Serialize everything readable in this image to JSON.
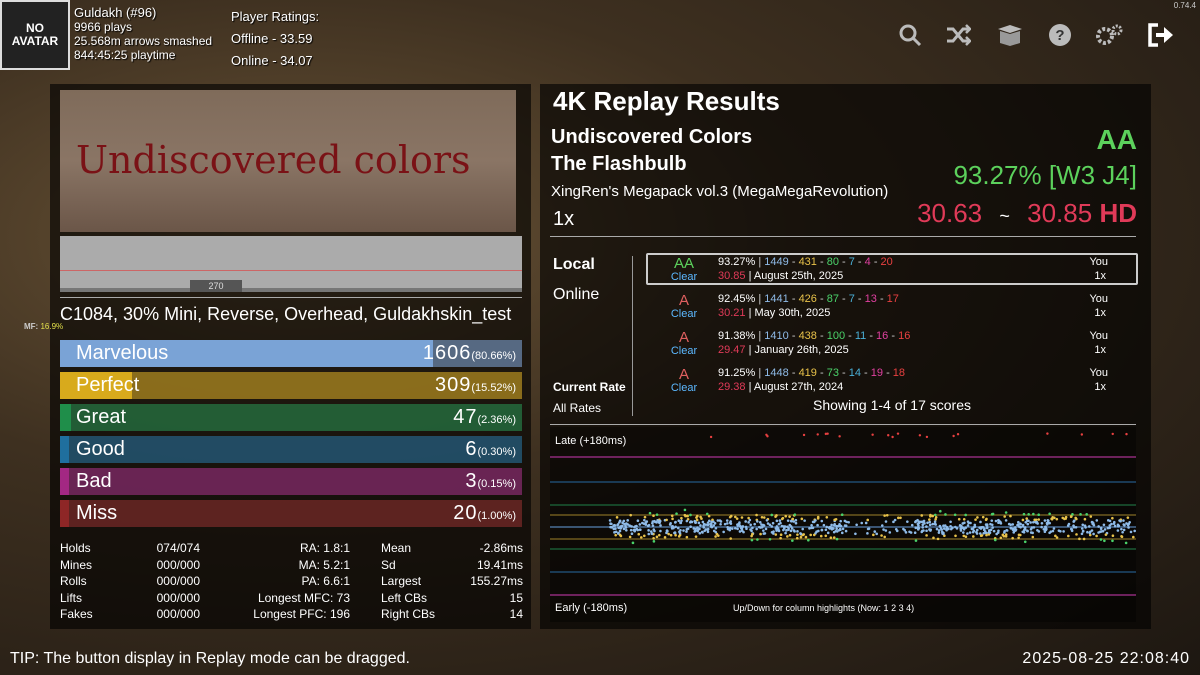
{
  "version": "0.74.4",
  "profile": {
    "avatar_line1": "NO",
    "avatar_line2": "AVATAR",
    "name": "Guldakh (#96)",
    "plays": "9966 plays",
    "arrows": "25.568m arrows smashed",
    "playtime": "844:45:25 playtime",
    "ratings_title": "Player Ratings:",
    "offline": "Offline - 33.59",
    "online": "Online - 34.07"
  },
  "toolbar": [
    "search-icon",
    "shuffle-icon",
    "box-icon",
    "help-icon",
    "settings-icon",
    "exit-icon"
  ],
  "banner": {
    "text": "Undiscovered colors"
  },
  "graph": {
    "caption": "270"
  },
  "mods": "C1084, 30% Mini, Reverse, Overhead, Guldakhskin_test",
  "mf": {
    "label": "MF:",
    "value": "16.9%"
  },
  "judgments": [
    {
      "name": "Marvelous",
      "count": "1606",
      "pct": "(80.66%)",
      "color": "#7aa3d6",
      "fill": 0.8066
    },
    {
      "name": "Perfect",
      "count": "309",
      "pct": "(15.52%)",
      "color": "#d8aa1c",
      "fill": 0.1552
    },
    {
      "name": "Great",
      "count": "47",
      "pct": "(2.36%)",
      "color": "#1f8e4a",
      "fill": 0.0236
    },
    {
      "name": "Good",
      "count": "6",
      "pct": "(0.30%)",
      "color": "#1f6f9e",
      "fill": 0.003
    },
    {
      "name": "Bad",
      "count": "3",
      "pct": "(0.15%)",
      "color": "#a32883",
      "fill": 0.0015
    },
    {
      "name": "Miss",
      "count": "20",
      "pct": "(1.00%)",
      "color": "#8e2626",
      "fill": 0.01
    }
  ],
  "stats_a": [
    {
      "label": "Holds",
      "value": "074/074"
    },
    {
      "label": "Mines",
      "value": "000/000"
    },
    {
      "label": "Rolls",
      "value": "000/000"
    },
    {
      "label": "Lifts",
      "value": "000/000"
    },
    {
      "label": "Fakes",
      "value": "000/000"
    }
  ],
  "stats_b": [
    "RA: 1.8:1",
    "MA: 5.2:1",
    "PA: 6.6:1",
    "Longest MFC: 73",
    "Longest PFC: 196"
  ],
  "stats_c": [
    {
      "label": "Mean",
      "value": "-2.86ms"
    },
    {
      "label": "Sd",
      "value": "19.41ms"
    },
    {
      "label": "Largest",
      "value": "155.27ms"
    },
    {
      "label": "Left CBs",
      "value": "15"
    },
    {
      "label": "Right CBs",
      "value": "14"
    }
  ],
  "results": {
    "title": "4K Replay Results",
    "song": "Undiscovered Colors",
    "artist": "The Flashbulb",
    "pack": "XingRen's Megapack vol.3 (MegaMegaRevolution)",
    "rate": "1x",
    "grade": "AA",
    "accuracy": "93.27%",
    "bracket": "[W3 J4]",
    "ssr1": "30.63",
    "tilde": "~",
    "ssr2": "30.85",
    "hd": "HD"
  },
  "tabs": {
    "local": "Local",
    "online": "Online",
    "current_rate": "Current Rate",
    "all_rates": "All Rates"
  },
  "scores": [
    {
      "grade": "AA",
      "grade_color": "#5cd15c",
      "clear": "Clear",
      "acc": "93.27%",
      "j": [
        "1449",
        "431",
        "80",
        "7",
        "4",
        "20"
      ],
      "ssr": "30.85",
      "date": "August 25th, 2025",
      "you": "You",
      "rate": "1x"
    },
    {
      "grade": "A",
      "grade_color": "#e06060",
      "clear": "Clear",
      "acc": "92.45%",
      "j": [
        "1441",
        "426",
        "87",
        "7",
        "13",
        "17"
      ],
      "ssr": "30.21",
      "date": "May 30th, 2025",
      "you": "You",
      "rate": "1x"
    },
    {
      "grade": "A",
      "grade_color": "#e06060",
      "clear": "Clear",
      "acc": "91.38%",
      "j": [
        "1410",
        "438",
        "100",
        "11",
        "16",
        "16"
      ],
      "ssr": "29.47",
      "date": "January 26th, 2025",
      "you": "You",
      "rate": "1x"
    },
    {
      "grade": "A",
      "grade_color": "#e06060",
      "clear": "Clear",
      "acc": "91.25%",
      "j": [
        "1448",
        "419",
        "73",
        "14",
        "19",
        "18"
      ],
      "ssr": "29.38",
      "date": "August 27th, 2024",
      "you": "You",
      "rate": "1x"
    }
  ],
  "showing": "Showing 1-4 of 17 scores",
  "offset_plot": {
    "late": "Late (+180ms)",
    "early": "Early (-180ms)",
    "hint": "Up/Down for column highlights (Now: 1 2 3 4)"
  },
  "tip": "TIP: The button display in Replay mode can be dragged.",
  "clock": "2025-08-25 22:08:40"
}
